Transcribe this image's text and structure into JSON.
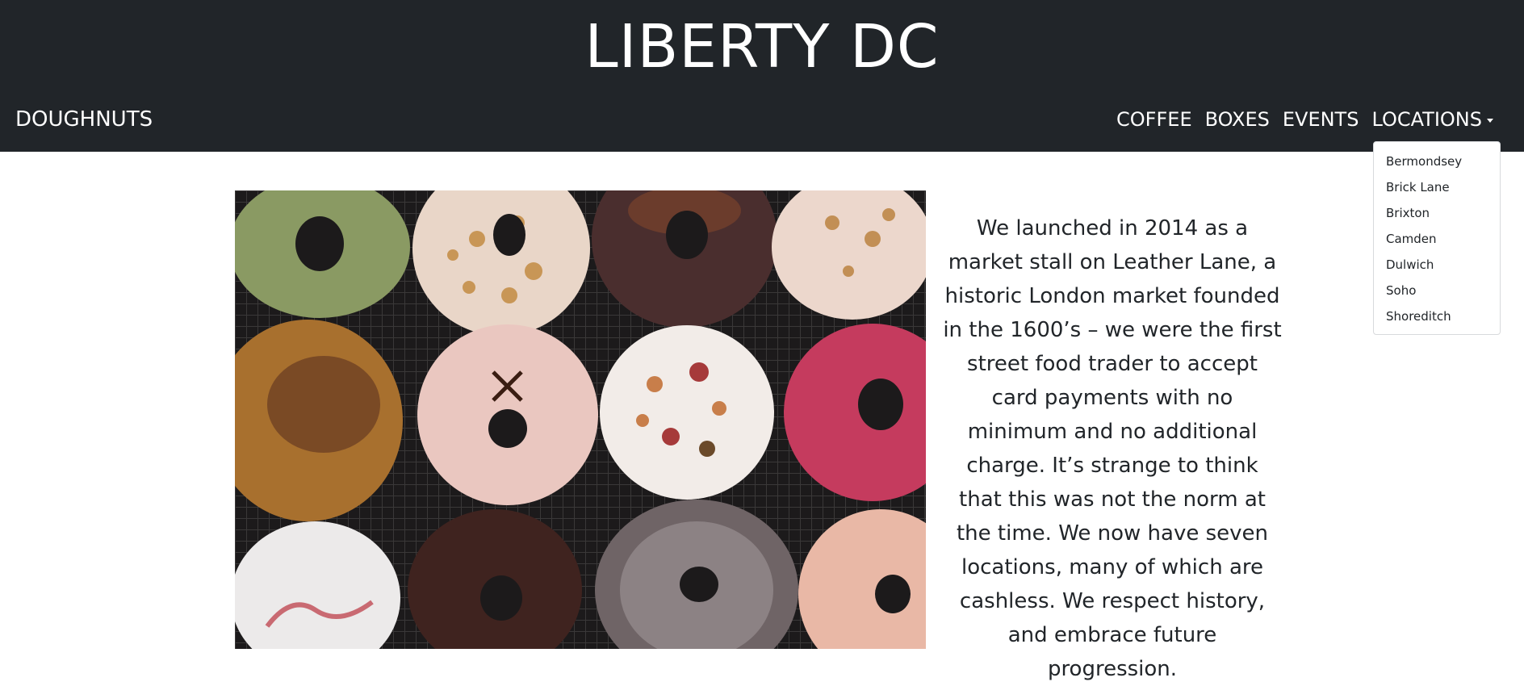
{
  "header": {
    "title": "LIBERTY DC",
    "brand": "DOUGHNUTS",
    "nav": [
      {
        "label": "COFFEE"
      },
      {
        "label": "BOXES"
      },
      {
        "label": "EVENTS"
      }
    ],
    "locations_label": "LOCATIONS"
  },
  "locations_menu": {
    "items": [
      "Bermondsey",
      "Brick Lane",
      "Brixton",
      "Camden",
      "Dulwich",
      "Soho",
      "Shoreditch"
    ]
  },
  "main": {
    "image_icon": "doughnuts-photo",
    "about": "We launched in 2014 as a market stall on Leather Lane, a historic London market founded in the 1600’s – we were the first street food trader to accept card payments with no minimum and no additional charge. It’s strange to think that this was not the norm at the time. We now have seven locations, many of which are cashless. We respect history, and embrace future progression."
  },
  "colors": {
    "header_bg": "#212529",
    "text": "#212529"
  }
}
